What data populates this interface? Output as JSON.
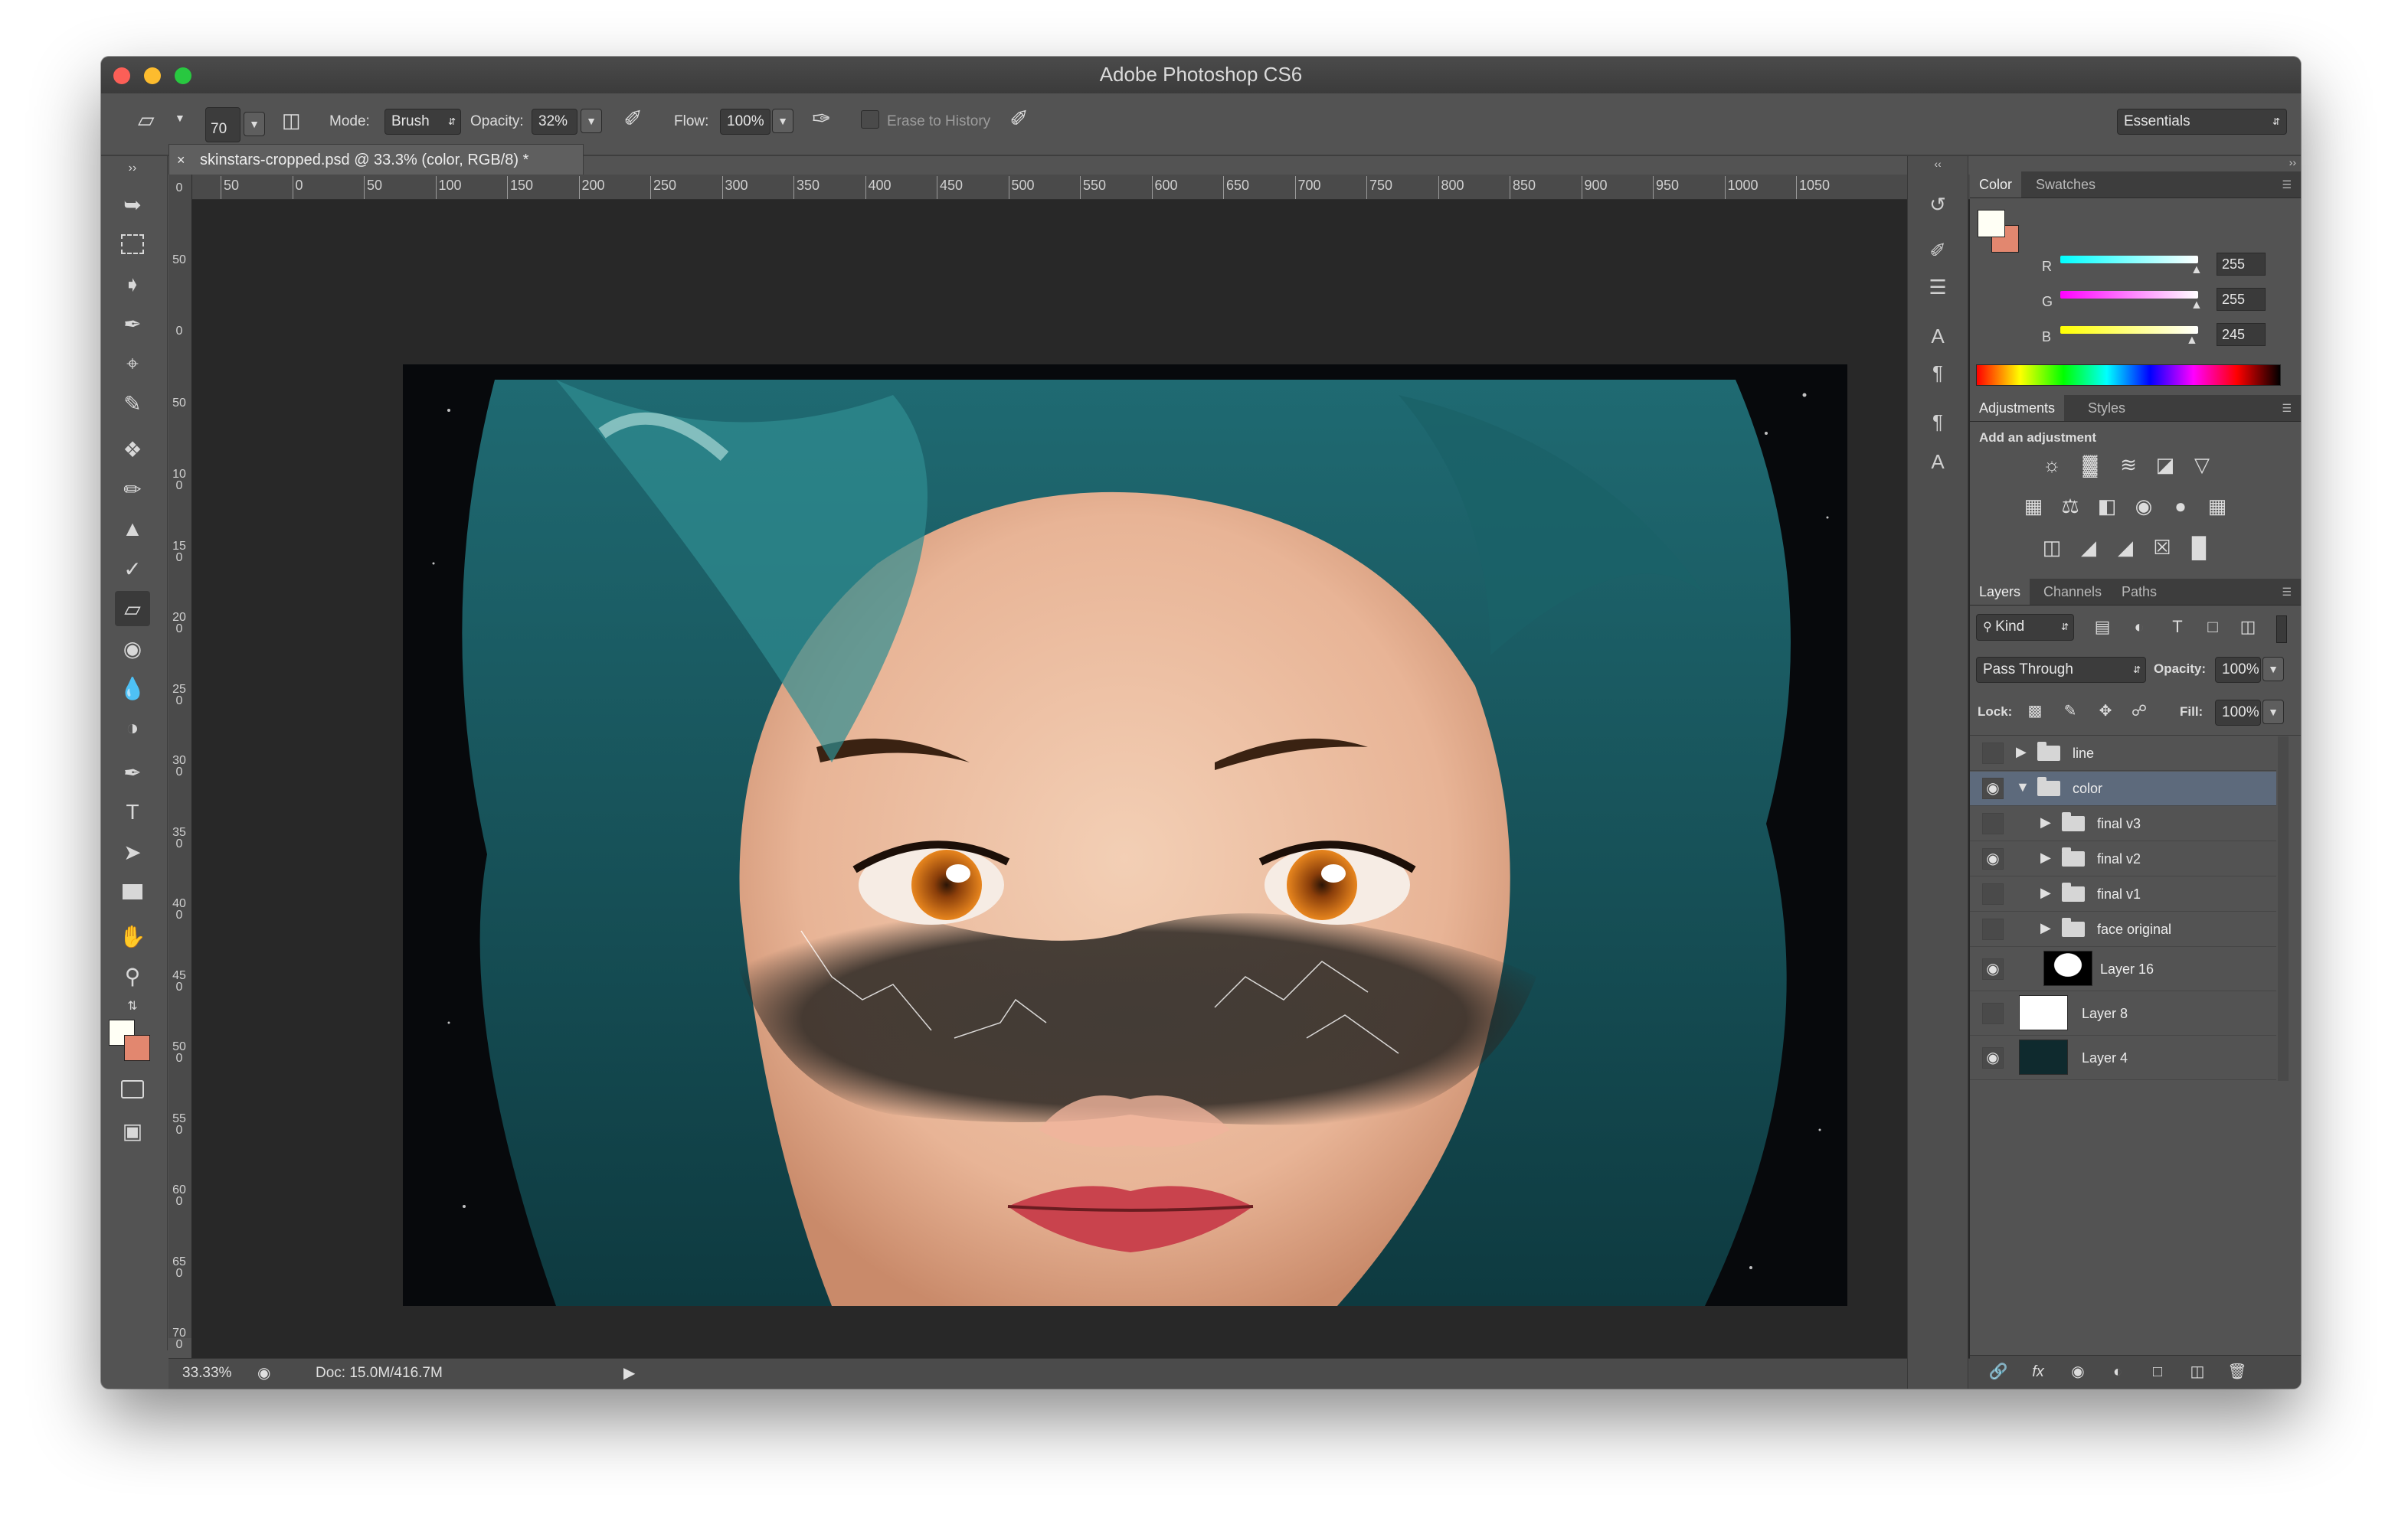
{
  "window": {
    "title": "Adobe Photoshop CS6"
  },
  "options_bar": {
    "brush_size": "70",
    "mode_label": "Mode:",
    "mode_value": "Brush",
    "opacity_label": "Opacity:",
    "opacity_value": "32%",
    "flow_label": "Flow:",
    "flow_value": "100%",
    "erase_to_history": "Erase to History",
    "workspace": "Essentials"
  },
  "document": {
    "tab_title": "skinstars-cropped.psd @ 33.3% (color, RGB/8) *",
    "h_ruler": [
      "50",
      "0",
      "50",
      "100",
      "150",
      "200",
      "250",
      "300",
      "350",
      "400",
      "450",
      "500",
      "550",
      "600",
      "650",
      "700",
      "750",
      "800",
      "850",
      "900",
      "950",
      "1000",
      "1050"
    ],
    "v_ruler": [
      "0",
      "50",
      "0",
      "50",
      "100",
      "150",
      "200",
      "250",
      "300",
      "350",
      "400",
      "450",
      "500",
      "550",
      "600",
      "650",
      "700"
    ]
  },
  "status_bar": {
    "zoom": "33.33%",
    "doc_info": "Doc: 15.0M/416.7M"
  },
  "color_panel": {
    "tabs": [
      "Color",
      "Swatches"
    ],
    "channels": [
      {
        "label": "R",
        "value": "255",
        "slider": 1.0
      },
      {
        "label": "G",
        "value": "255",
        "slider": 1.0
      },
      {
        "label": "B",
        "value": "245",
        "slider": 0.96
      }
    ],
    "foreground": "#fffff5",
    "background": "#e2876f"
  },
  "adjustments_panel": {
    "tabs": [
      "Adjustments",
      "Styles"
    ],
    "heading": "Add an adjustment",
    "icons": [
      "brightness-contrast-icon",
      "levels-icon",
      "curves-icon",
      "exposure-icon",
      "vibrance-icon",
      "hue-saturation-icon",
      "color-balance-icon",
      "black-white-icon",
      "photo-filter-icon",
      "channel-mixer-icon",
      "color-lookup-icon",
      "invert-icon",
      "posterize-icon",
      "threshold-icon",
      "selective-color-icon",
      "gradient-map-icon"
    ]
  },
  "layers_panel": {
    "tabs": [
      "Layers",
      "Channels",
      "Paths"
    ],
    "filter_kind": "Kind",
    "blend_mode": "Pass Through",
    "opacity_label": "Opacity:",
    "opacity_value": "100%",
    "lock_label": "Lock:",
    "fill_label": "Fill:",
    "fill_value": "100%",
    "layers": [
      {
        "name": "line",
        "visible": false
      },
      {
        "name": "color",
        "visible": true
      },
      {
        "name": "final v3",
        "visible": false
      },
      {
        "name": "final v2",
        "visible": true
      },
      {
        "name": "final v1",
        "visible": false
      },
      {
        "name": "face original",
        "visible": false
      },
      {
        "name": "Layer 16",
        "visible": true
      },
      {
        "name": "Layer 8",
        "visible": false
      },
      {
        "name": "Layer 4",
        "visible": true
      }
    ]
  }
}
